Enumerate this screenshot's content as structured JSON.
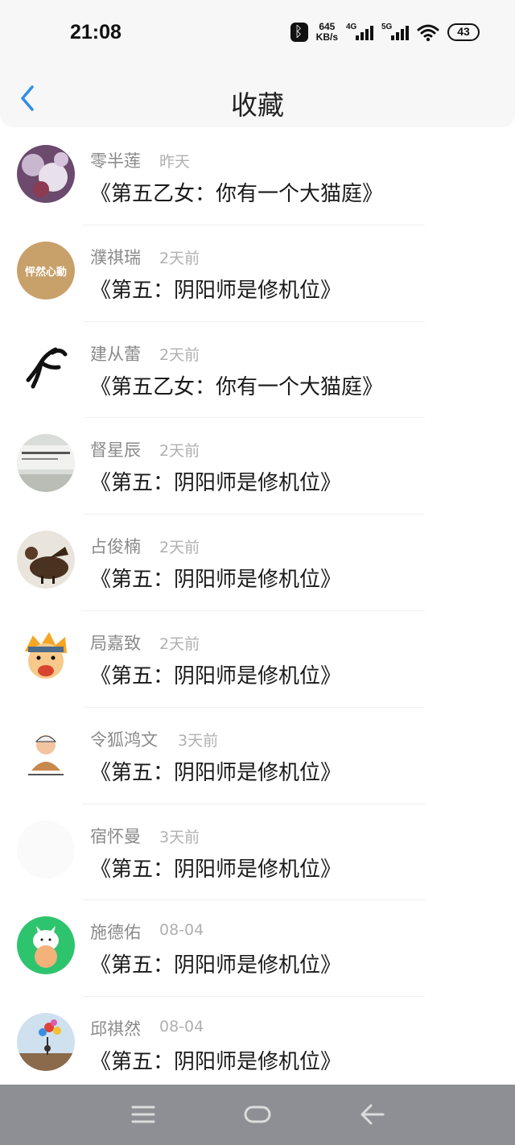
{
  "status_bar": {
    "time": "21:08",
    "net_speed_value": "645",
    "net_speed_unit": "KB/s",
    "signal1_tag": "4G",
    "signal2_tag": "5G",
    "battery": "43",
    "icons": [
      "bluetooth-icon",
      "signal-4g-icon",
      "signal-5g-icon",
      "wifi-icon",
      "battery-icon"
    ]
  },
  "nav": {
    "title": "收藏",
    "back_icon": "chevron-left-icon",
    "accent_color": "#2f8ee6"
  },
  "items": [
    {
      "name": "零半莲",
      "time": "昨天",
      "title": "《第五乙女：你有一个大猫庭》"
    },
    {
      "name": "濮祺瑞",
      "time": "2天前",
      "title": "《第五：阴阳师是修机位》",
      "avatar_text": "怦然心動"
    },
    {
      "name": "建从蕾",
      "time": "2天前",
      "title": "《第五乙女：你有一个大猫庭》"
    },
    {
      "name": "督星辰",
      "time": "2天前",
      "title": "《第五：阴阳师是修机位》"
    },
    {
      "name": "占俊楠",
      "time": "2天前",
      "title": "《第五：阴阳师是修机位》"
    },
    {
      "name": "局嘉致",
      "time": "2天前",
      "title": "《第五：阴阳师是修机位》"
    },
    {
      "name": "令狐鸿文",
      "time": "3天前",
      "title": "《第五：阴阳师是修机位》"
    },
    {
      "name": "宿怀曼",
      "time": "3天前",
      "title": "《第五：阴阳师是修机位》"
    },
    {
      "name": "施德佑",
      "time": "08-04",
      "title": "《第五：阴阳师是修机位》"
    },
    {
      "name": "邱祺然",
      "time": "08-04",
      "title": "《第五：阴阳师是修机位》"
    }
  ],
  "bottom_nav": {
    "icons": [
      "menu-icon",
      "home-icon",
      "back-arrow-icon"
    ],
    "background": "#8e8f94"
  }
}
